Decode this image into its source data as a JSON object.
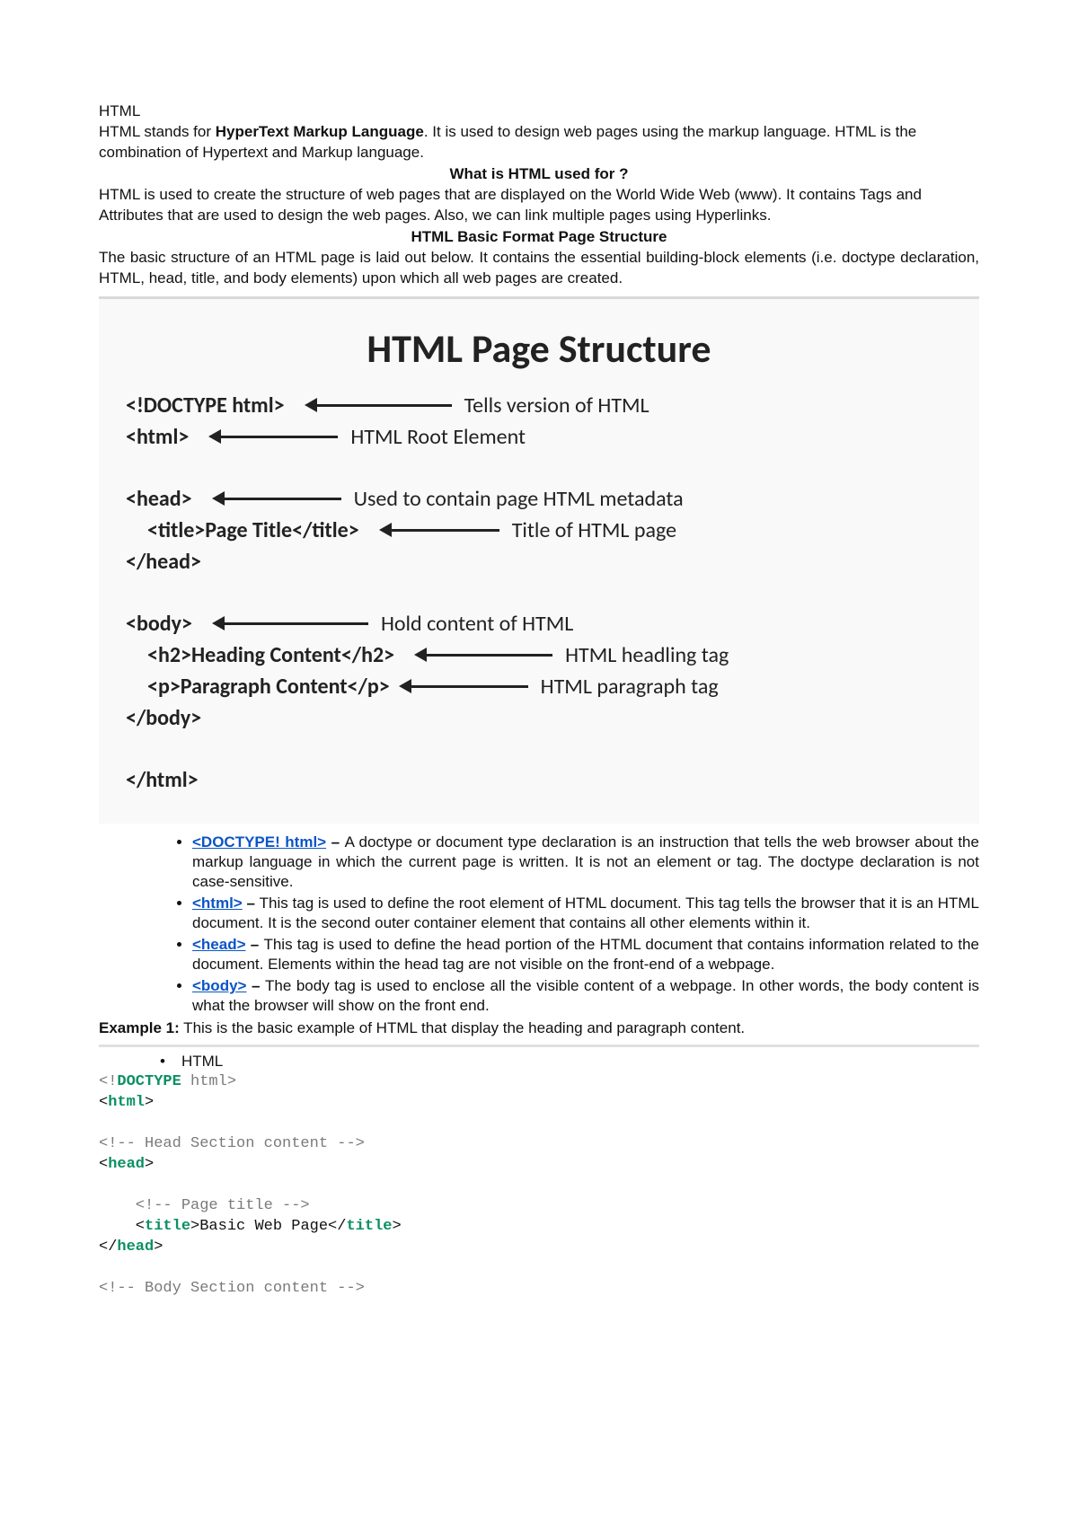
{
  "title": "HTML",
  "intro": {
    "prefix": "HTML stands for ",
    "bold": "HyperText Markup Language",
    "suffix": ". It is used to design web pages using the markup language. HTML is the combination of Hypertext and Markup language."
  },
  "usedForHeading": "What is HTML used for ?",
  "usedForPara": "HTML is used to create the structure of web pages that are displayed on the World Wide Web (www). It contains Tags and Attributes that are used to design the web pages. Also, we can link multiple pages using Hyperlinks.",
  "basicHeading": "HTML Basic Format Page Structure",
  "basicPara": "The basic structure of an HTML page is laid out below. It contains the essential building-block elements (i.e. doctype declaration, HTML, head, title, and body elements) upon which all web pages are created.",
  "diagramTitle": "HTML Page Structure",
  "diagramRows": {
    "doctype": {
      "tag": "<!DOCTYPE html>",
      "desc": "Tells version of HTML"
    },
    "html": {
      "tag": "<html>",
      "desc": "HTML Root Element"
    },
    "head": {
      "tag": "<head>",
      "desc": "Used to contain  page HTML metadata"
    },
    "title": {
      "tag": "<title>Page Title</title>",
      "desc": "Title of HTML page"
    },
    "headClose": {
      "tag": "</head>"
    },
    "body": {
      "tag": "<body>",
      "desc": "Hold content of HTML"
    },
    "h2": {
      "tag": "<h2>Heading Content</h2>",
      "desc": "HTML headling tag"
    },
    "p": {
      "tag": "<p>Paragraph Content</p>",
      "desc": "HTML paragraph tag"
    },
    "bodyClose": {
      "tag": "</body>"
    },
    "htmlClose": {
      "tag": "</html>"
    }
  },
  "bullets": [
    {
      "link": "<DOCTYPE! html>",
      "text": "A doctype or document type declaration is an instruction that tells the web browser about the markup language in which the current page is written. It is not an element or tag. The doctype declaration is not case-sensitive."
    },
    {
      "link": "<html>",
      "text": "This tag is used to define the root element of HTML document. This tag tells the browser that it is an HTML document. It is the second outer container element that contains all other elements within it."
    },
    {
      "link": "<head>",
      "text": "This tag is used to define the head portion of the HTML document that contains information related to the document. Elements within the head tag are not visible on the front-end of a webpage."
    },
    {
      "link": "<body>",
      "text": "The body tag is used to enclose all the visible content of a webpage. In other words, the body content is what the browser will show on the front end."
    }
  ],
  "example": {
    "labelBold": "Example 1:",
    "labelText": " This is the basic example of HTML that display the heading and paragraph content."
  },
  "code": {
    "bullet": "HTML",
    "line1a": "<!",
    "line1b": "DOCTYPE",
    "line1c": " html",
    "line1d": ">",
    "line2a": "<",
    "line2b": "html",
    "line2c": ">",
    "line3": "<!-- Head Section content -->",
    "line4a": "<",
    "line4b": "head",
    "line4c": ">",
    "line5": "    <!-- Page title -->",
    "line6a": "    <",
    "line6b": "title",
    "line6c": ">Basic Web Page</",
    "line6d": "title",
    "line6e": ">",
    "line7a": "</",
    "line7b": "head",
    "line7c": ">",
    "line8": "<!-- Body Section content -->"
  }
}
